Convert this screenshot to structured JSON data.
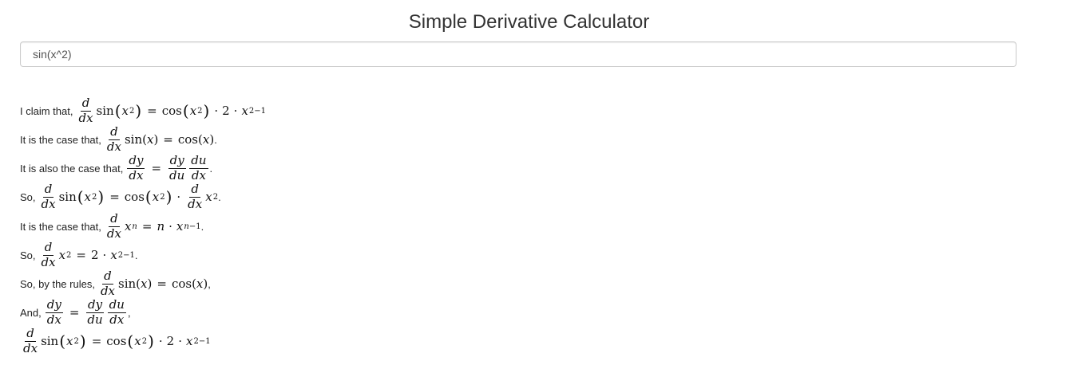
{
  "title": "Simple Derivative Calculator",
  "input": {
    "value": "sin(x^2)"
  },
  "steps": [
    {
      "lead": "I claim that,",
      "tail": ""
    },
    {
      "lead": "It is the case that,",
      "tail": "."
    },
    {
      "lead": "It is also the case that,",
      "tail": "."
    },
    {
      "lead": "So,",
      "tail": "."
    },
    {
      "lead": "It is the case that,",
      "tail": "."
    },
    {
      "lead": "So,",
      "tail": "."
    },
    {
      "lead": "So, by the rules,",
      "tail": ","
    },
    {
      "lead": "And,",
      "tail": ","
    },
    {
      "lead": "",
      "tail": ""
    }
  ]
}
